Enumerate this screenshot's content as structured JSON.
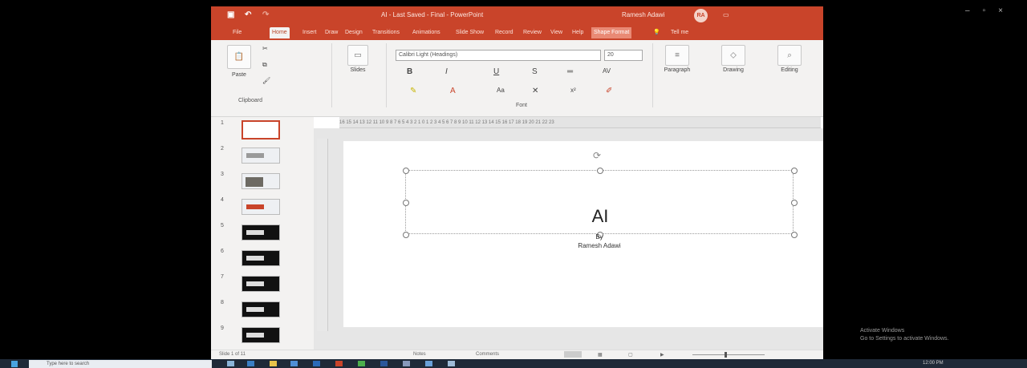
{
  "window": {
    "document_title": "AI - Last Saved - Final - PowerPoint",
    "user_name": "Ramesh Adawi",
    "user_initials": "RA",
    "options_label": "▭"
  },
  "tabs": [
    {
      "label": "File"
    },
    {
      "label": "Home"
    },
    {
      "label": "Insert"
    },
    {
      "label": "Draw"
    },
    {
      "label": "Design"
    },
    {
      "label": "Transitions"
    },
    {
      "label": "Animations"
    },
    {
      "label": "Slide Show"
    },
    {
      "label": "Record"
    },
    {
      "label": "Review"
    },
    {
      "label": "View"
    },
    {
      "label": "Help"
    },
    {
      "label": "Shape Format"
    },
    {
      "label": "Tell me"
    }
  ],
  "ribbon": {
    "clipboard": {
      "paste_label": "Paste",
      "group_label": "Clipboard"
    },
    "slides": {
      "label": "Slides"
    },
    "font": {
      "font_name": "Calibri Light (Headings)",
      "font_size": "20",
      "bold": "B",
      "italic": "I",
      "underline": "U",
      "strike": "S",
      "group_label": "Font"
    },
    "paragraph_label": "Paragraph",
    "drawing_label": "Drawing",
    "editing_label": "Editing"
  },
  "thumbnails": [
    {
      "num": "1"
    },
    {
      "num": "2"
    },
    {
      "num": "3"
    },
    {
      "num": "4"
    },
    {
      "num": "5"
    },
    {
      "num": "6"
    },
    {
      "num": "7"
    },
    {
      "num": "8"
    },
    {
      "num": "9"
    }
  ],
  "ruler_text": "16 15 14 13 12 11 10 9 8 7 6 5 4 3 2 1 0 1 2 3 4 5 6 7 8 9 10 11 12 13 14 15 16 17 18 19 20 21 22 23",
  "slide": {
    "title": "AI",
    "subtitle_line1": "By",
    "subtitle_line2": "Ramesh Adawi"
  },
  "status": {
    "slide_counter": "Slide 1 of 11",
    "notes_label": "Notes",
    "comments_label": "Comments"
  },
  "watermark": {
    "line1": "Activate Windows",
    "line2": "Go to Settings to activate Windows."
  },
  "taskbar": {
    "search_placeholder": "Type here to search",
    "clock": "12:00 PM"
  },
  "colors": {
    "accent": "#c9442a",
    "taskbar": "#1f2a38"
  }
}
